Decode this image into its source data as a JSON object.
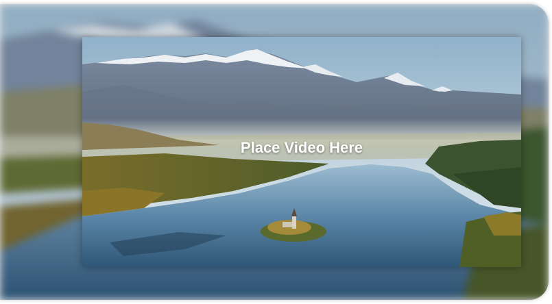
{
  "video": {
    "placeholder_label": "Place Video Here"
  },
  "colors": {
    "sky": "#b9cfdc",
    "mountain": "#6f7f96",
    "lake": "#3f6b8f",
    "forest": "#5d6a35"
  }
}
